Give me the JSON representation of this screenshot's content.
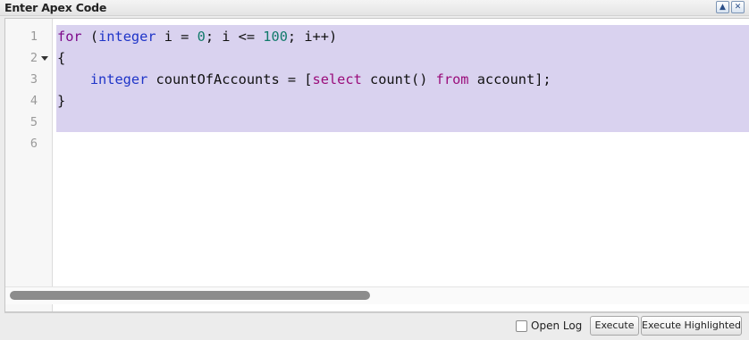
{
  "window": {
    "title": "Enter Apex Code",
    "minimize_icon": "▲",
    "close_icon": "✕"
  },
  "editor": {
    "line_numbers": [
      "1",
      "2",
      "3",
      "4",
      "5",
      "6"
    ],
    "lines": [
      {
        "tokens": [
          {
            "text": "for",
            "kind": "kw-for"
          },
          {
            "text": " (",
            "kind": "plain"
          },
          {
            "text": "integer",
            "kind": "kw-type"
          },
          {
            "text": " i = ",
            "kind": "plain"
          },
          {
            "text": "0",
            "kind": "num"
          },
          {
            "text": "; i <= ",
            "kind": "plain"
          },
          {
            "text": "100",
            "kind": "num"
          },
          {
            "text": "; i++)",
            "kind": "plain"
          }
        ]
      },
      {
        "tokens": [
          {
            "text": "{",
            "kind": "plain"
          }
        ]
      },
      {
        "tokens": [
          {
            "text": "    ",
            "kind": "plain"
          },
          {
            "text": "integer",
            "kind": "kw-type"
          },
          {
            "text": " countOfAccounts = [",
            "kind": "plain"
          },
          {
            "text": "select",
            "kind": "sel-kw"
          },
          {
            "text": " count() ",
            "kind": "plain"
          },
          {
            "text": "from",
            "kind": "sel-kw"
          },
          {
            "text": " account];",
            "kind": "plain"
          }
        ]
      },
      {
        "tokens": [
          {
            "text": "}",
            "kind": "plain"
          }
        ]
      },
      {
        "tokens": []
      },
      {
        "tokens": []
      }
    ],
    "colors": {
      "selection": "#d9d2ef",
      "keyword_for": "#7d0a8a",
      "keyword_type": "#1f35c8",
      "number": "#117a6a",
      "soql_keyword": "#9a0c7a"
    }
  },
  "footer": {
    "open_log_label": "Open Log",
    "open_log_checked": false,
    "execute_label": "Execute",
    "execute_highlighted_label": "Execute Highlighted"
  }
}
